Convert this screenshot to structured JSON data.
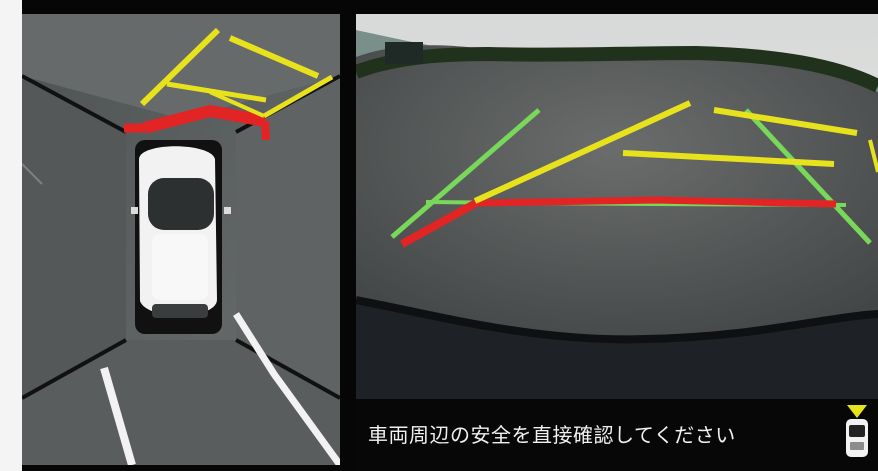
{
  "screen": {
    "name": "parking-camera-display",
    "views": {
      "top_view": "bird-eye-view",
      "rear_view": "rear-camera-view"
    }
  },
  "caption": {
    "text": "車両周辺の安全を直接確認してください"
  },
  "icons": {
    "car_status": "car-rear-warning-icon"
  },
  "colors": {
    "guide_yellow": "#e8e21c",
    "guide_red": "#e22424",
    "guide_green": "#79d85a",
    "vehicle_white": "#f2f2f2"
  }
}
